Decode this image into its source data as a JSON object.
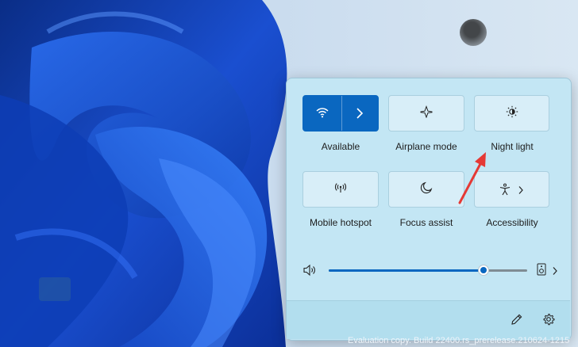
{
  "quick_settings": {
    "tiles": [
      {
        "label": "Available",
        "icon": "wifi-icon",
        "active": true
      },
      {
        "label": "Airplane mode",
        "icon": "airplane-icon",
        "active": false
      },
      {
        "label": "Night light",
        "icon": "brightness-icon",
        "active": false
      },
      {
        "label": "Mobile hotspot",
        "icon": "hotspot-icon",
        "active": false
      },
      {
        "label": "Focus assist",
        "icon": "moon-icon",
        "active": false
      },
      {
        "label": "Accessibility",
        "icon": "accessibility-icon",
        "active": false
      }
    ],
    "volume": {
      "level_percent": 78
    },
    "footer_icons": [
      "edit-icon",
      "settings-icon"
    ]
  },
  "watermark": "Evaluation copy. Build 22400.rs_prerelease.210624-1215",
  "colors": {
    "accent": "#0a67c0",
    "panel_bg": "#c3e6f4",
    "annotation_arrow": "#e53935"
  }
}
